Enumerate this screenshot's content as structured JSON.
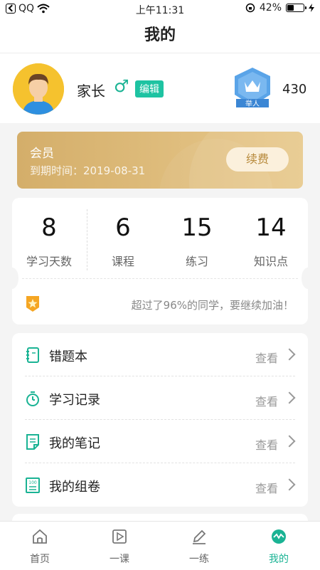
{
  "status_bar": {
    "app_back": "QQ",
    "time": "上午11:31",
    "battery": "42%",
    "battery_level": 0.42
  },
  "nav": {
    "title": "我的"
  },
  "profile": {
    "name": "家长",
    "gender_symbol": "♂",
    "edit_label": "编辑",
    "rank_label": "举人",
    "score": "430"
  },
  "vip": {
    "title": "会员",
    "expire_label": "到期时间：",
    "expire_date": "2019-08-31",
    "renew_label": "续费"
  },
  "stats": {
    "items": [
      {
        "value": "8",
        "label": "学习天数"
      },
      {
        "value": "6",
        "label": "课程"
      },
      {
        "value": "15",
        "label": "练习"
      },
      {
        "value": "14",
        "label": "知识点"
      }
    ],
    "encourage": "超过了96%的同学，要继续加油！"
  },
  "menu": {
    "view_label": "查看",
    "items": [
      {
        "label": "错题本",
        "icon": "wrong-book-icon"
      },
      {
        "label": "学习记录",
        "icon": "stopwatch-icon"
      },
      {
        "label": "我的笔记",
        "icon": "notes-icon"
      },
      {
        "label": "我的组卷",
        "icon": "test-paper-icon"
      }
    ]
  },
  "tabs": [
    {
      "label": "首页",
      "icon": "home-icon"
    },
    {
      "label": "一课",
      "icon": "play-icon"
    },
    {
      "label": "一练",
      "icon": "pencil-icon"
    },
    {
      "label": "我的",
      "icon": "wave-icon",
      "active": true
    }
  ],
  "colors": {
    "accent": "#1ab394",
    "edit_bg": "#1ec3a2",
    "vip_gold": "#d4ae6a",
    "renew_text": "#b7893a"
  }
}
